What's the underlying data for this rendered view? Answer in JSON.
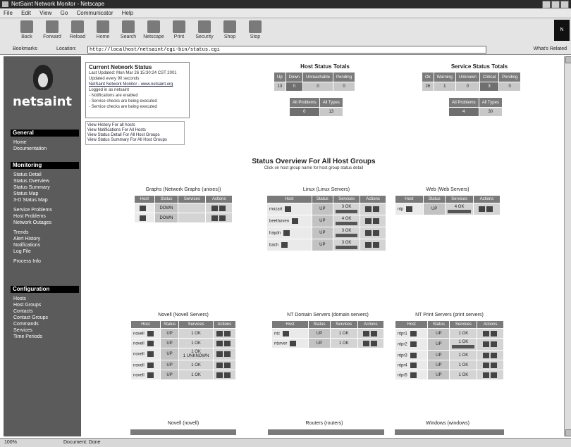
{
  "window": {
    "title": "NetSaint Network Monitor - Netscape"
  },
  "menu": [
    "File",
    "Edit",
    "View",
    "Go",
    "Communicator",
    "Help"
  ],
  "toolbar": [
    {
      "label": "Back",
      "icon": "back-icon"
    },
    {
      "label": "Forward",
      "icon": "forward-icon"
    },
    {
      "label": "Reload",
      "icon": "reload-icon"
    },
    {
      "label": "Home",
      "icon": "home-icon"
    },
    {
      "label": "Search",
      "icon": "search-icon"
    },
    {
      "label": "Netscape",
      "icon": "netscape-icon"
    },
    {
      "label": "Print",
      "icon": "print-icon"
    },
    {
      "label": "Security",
      "icon": "security-icon"
    },
    {
      "label": "Shop",
      "icon": "shop-icon"
    },
    {
      "label": "Stop",
      "icon": "stop-icon"
    }
  ],
  "location": {
    "bookmarks_label": "Bookmarks",
    "location_label": "Location:",
    "url": "http://localhost/netsaint/cgi-bin/status.cgi",
    "related_label": "What's Related"
  },
  "sidebar": {
    "brand": "netsaint",
    "sections": [
      {
        "title": "General",
        "items": [
          "Home",
          "Documentation"
        ]
      },
      {
        "title": "Monitoring",
        "items": [
          "Status Detail",
          "Status Overview",
          "Status Summary",
          "Status Map",
          "3-D Status Map",
          "Service Problems",
          "Host Problems",
          "Network Outages",
          "Trends",
          "Alert History",
          "Notifications",
          "Log File",
          "Process Info"
        ]
      },
      {
        "title": "Configuration",
        "items": [
          "Hosts",
          "Host Groups",
          "Contacts",
          "Contact Groups",
          "Commands",
          "Services",
          "Time Periods"
        ]
      }
    ]
  },
  "current_status": {
    "title": "Current Network Status",
    "lines": [
      "Last Updated: Mon Mar 26 15:30:24 CST 2001",
      "Updated every 90 seconds",
      "NetSaint Network Monitor - www.netsaint.org",
      "Logged in as netsaint",
      "- Notifications are enabled",
      "- Service checks are being executed",
      "- Service checks are being executed"
    ],
    "view_links": [
      "View History For all hosts",
      "View Notifications For All Hosts",
      "View Status Detail For All Host Groups",
      "View Status Summary For All Host Groups"
    ]
  },
  "host_totals": {
    "title": "Host Status Totals",
    "headers": [
      "Up",
      "Down",
      "Unreachable",
      "Pending"
    ],
    "values": [
      "13",
      "0",
      "0",
      "0"
    ],
    "all_headers": [
      "All Problems",
      "All Types"
    ],
    "all_values": [
      "0",
      "13"
    ]
  },
  "service_totals": {
    "title": "Service Status Totals",
    "headers": [
      "Ok",
      "Warning",
      "Unknown",
      "Critical",
      "Pending"
    ],
    "values": [
      "26",
      "1",
      "0",
      "3",
      "0"
    ],
    "all_headers": [
      "All Problems",
      "All Types"
    ],
    "all_values": [
      "4",
      "30"
    ]
  },
  "overview": {
    "title": "Status Overview For All Host Groups",
    "subtitle": "Click on host group name for host group status detail",
    "columns": [
      "Host",
      "Status",
      "Services",
      "Actions"
    ],
    "groups": [
      {
        "name": "Graphs (Network Graphs (unixes))",
        "rows": [
          {
            "host": "",
            "status": "DOWN",
            "services": "",
            "svcbar": false
          },
          {
            "host": "",
            "status": "DOWN",
            "services": "",
            "svcbar": false
          }
        ]
      },
      {
        "name": "Linux (Linux Servers)",
        "rows": [
          {
            "host": "mozart",
            "status": "UP",
            "services": "3 OK",
            "svcbar": true
          },
          {
            "host": "beethoven",
            "status": "UP",
            "services": "4 OK",
            "svcbar": true
          },
          {
            "host": "haydn",
            "status": "UP",
            "services": "3 OK",
            "svcbar": true
          },
          {
            "host": "bach",
            "status": "UP",
            "services": "3 OK",
            "svcbar": true
          }
        ]
      },
      {
        "name": "Web (Web Servers)",
        "rows": [
          {
            "host": "ntp",
            "status": "UP",
            "services": "4 OK",
            "svcbar": true
          }
        ]
      },
      {
        "name": "Novell (Novell Servers)",
        "rows": [
          {
            "host": "novell",
            "status": "UP",
            "services": "1 OK",
            "svcbar": false
          },
          {
            "host": "novell",
            "status": "UP",
            "services": "1 OK",
            "svcbar": false
          },
          {
            "host": "novell",
            "status": "UP",
            "services": "1 OK\n1 UNKNOWN",
            "svcbar": false
          },
          {
            "host": "novell",
            "status": "UP",
            "services": "1 OK",
            "svcbar": false
          },
          {
            "host": "novell",
            "status": "UP",
            "services": "1 OK",
            "svcbar": false
          }
        ]
      },
      {
        "name": "NT Domain Servers (domain servers)",
        "rows": [
          {
            "host": "ntc",
            "status": "UP",
            "services": "1 OK",
            "svcbar": false
          },
          {
            "host": "ntsrver",
            "status": "UP",
            "services": "1 OK",
            "svcbar": false
          }
        ]
      },
      {
        "name": "NT Print Servers (print servers)",
        "rows": [
          {
            "host": "ntpr1",
            "status": "UP",
            "services": "1 OK",
            "svcbar": false
          },
          {
            "host": "ntpr2",
            "status": "UP",
            "services": "1 OK",
            "svcbar": true
          },
          {
            "host": "ntpr3",
            "status": "UP",
            "services": "1 OK",
            "svcbar": false
          },
          {
            "host": "ntpr4",
            "status": "UP",
            "services": "1 OK",
            "svcbar": false
          },
          {
            "host": "ntpr5",
            "status": "UP",
            "services": "1 OK",
            "svcbar": false
          }
        ]
      }
    ],
    "bottom_titles": [
      "Novell (novell)",
      "Routers (routers)",
      "Windows (windows)"
    ]
  },
  "statusbar": {
    "left": "100%",
    "center": "Document: Done"
  }
}
